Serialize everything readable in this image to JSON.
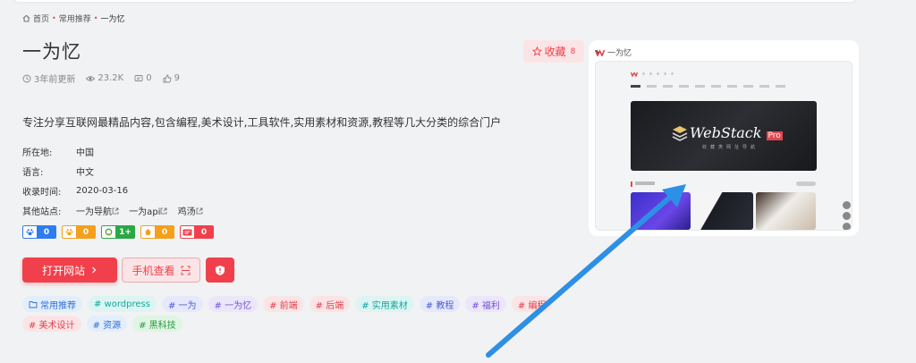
{
  "breadcrumb": {
    "home": "首页",
    "section": "常用推荐",
    "current": "一为忆"
  },
  "site": {
    "title": "一为忆",
    "updated": "3年前更新",
    "views": "23.2K",
    "comments": "0",
    "likes": "9",
    "description": "专注分享互联网最精品内容,包含编程,美术设计,工具软件,实用素材和资源,教程等几大分类的综合门户"
  },
  "favorite": {
    "label": "收藏",
    "count": "8"
  },
  "info": {
    "location_key": "所在地:",
    "location_val": "中国",
    "language_key": "语言:",
    "language_val": "中文",
    "date_key": "收录时间:",
    "date_val": "2020-03-16",
    "other_key": "其他站点:",
    "other_sites": [
      "一为导航",
      "一为api",
      "鸡汤"
    ]
  },
  "badges": [
    {
      "icon": "baidu-paw-icon",
      "value": "0",
      "color": "#2f7bf0"
    },
    {
      "icon": "baidu-mobile-paw-icon",
      "value": "0",
      "color": "#f4a01c"
    },
    {
      "icon": "360-icon",
      "value": "1+",
      "color": "#2aa846"
    },
    {
      "icon": "sogou-icon",
      "value": "0",
      "color": "#f4a01c"
    },
    {
      "icon": "shenma-icon",
      "value": "0",
      "color": "#f1404b"
    }
  ],
  "actions": {
    "open_site": "打开网站",
    "mobile_view": "手机查看"
  },
  "tags": [
    {
      "label": "常用推荐",
      "style": "blue",
      "icon": "folder"
    },
    {
      "label": "# wordpress",
      "style": "teal"
    },
    {
      "label": "# 一为",
      "style": "indigo"
    },
    {
      "label": "# 一为忆",
      "style": "purple"
    },
    {
      "label": "# 前端",
      "style": "red"
    },
    {
      "label": "# 后端",
      "style": "red"
    },
    {
      "label": "# 实用素材",
      "style": "teal"
    },
    {
      "label": "# 教程",
      "style": "indigo"
    },
    {
      "label": "# 福利",
      "style": "purple"
    },
    {
      "label": "# 编程",
      "style": "red"
    },
    {
      "label": "# 美术设计",
      "style": "red"
    },
    {
      "label": "# 资源",
      "style": "blue"
    },
    {
      "label": "# 黑科技",
      "style": "green"
    }
  ],
  "preview": {
    "title": "一为忆",
    "banner_brand": "WebStack",
    "banner_pro": "Pro",
    "banner_sub": "收藏类网址导航"
  },
  "colors": {
    "accent": "#f1404b",
    "arrow": "#2d8fe6"
  }
}
